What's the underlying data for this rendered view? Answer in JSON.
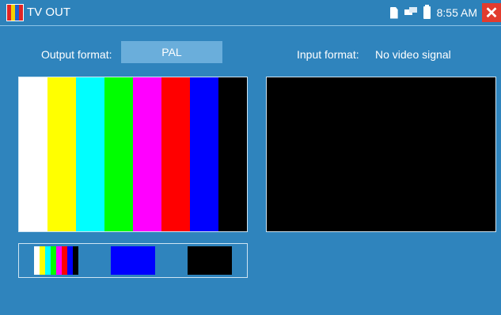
{
  "titlebar": {
    "title": "TV OUT",
    "time": "8:55 AM",
    "close_icon": "close-x-icon",
    "status_icons": [
      "sd-card-icon",
      "network-icon",
      "battery-icon"
    ]
  },
  "output": {
    "label": "Output format:",
    "value": "PAL"
  },
  "input": {
    "label": "Input format:",
    "value": "No video signal"
  },
  "color_bars": [
    "#ffffff",
    "#ffff00",
    "#00ffff",
    "#00ff00",
    "#ff00ff",
    "#ff0000",
    "#0000ff",
    "#000000"
  ],
  "thumbnails": [
    {
      "name": "color-bars-pattern",
      "kind": "bars"
    },
    {
      "name": "blue-pattern",
      "color": "#0000ff"
    },
    {
      "name": "black-pattern",
      "color": "#000000"
    }
  ],
  "colors": {
    "background": "#2f84bd",
    "format_box": "#6aaedb",
    "close_button": "#e23b2e"
  }
}
